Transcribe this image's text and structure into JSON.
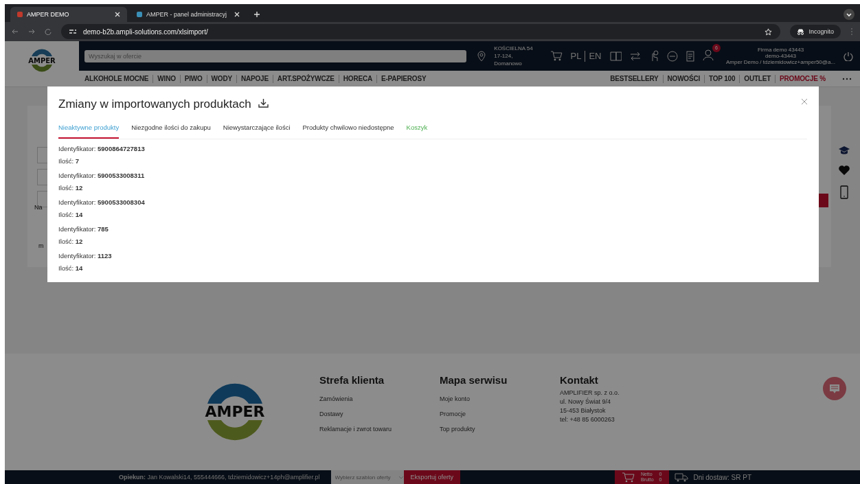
{
  "browser": {
    "tabs": [
      {
        "title": "AMPER DEMO",
        "selected": true
      },
      {
        "title": "AMPER - panel administracyj",
        "selected": false
      }
    ],
    "url": "demo-b2b.ampli-solutions.com/xlsimport/",
    "profile": "Incognito"
  },
  "header": {
    "logo": "AMPER",
    "search": {
      "placeholder": "Wyszukaj w ofercie"
    },
    "address": [
      "KOŚCIELNA 54",
      "17-124, Domanowo"
    ],
    "languages": [
      "PL",
      "EN"
    ],
    "notifications": "6",
    "account": [
      "Firma demo 43443",
      "demo-43443",
      "Amper Demo / tdziemidowicz+amper50@a..."
    ]
  },
  "categories": [
    {
      "label": "ALKOHOLE MOCNE",
      "promo": false
    },
    {
      "label": "WINO",
      "promo": false
    },
    {
      "label": "PIWO",
      "promo": false
    },
    {
      "label": "WODY",
      "promo": false
    },
    {
      "label": "NAPOJE",
      "promo": false
    },
    {
      "label": "ART.SPOŻYWCZE",
      "promo": false
    },
    {
      "label": "HORECA",
      "promo": false
    },
    {
      "label": "E-PAPIEROSY",
      "promo": false
    }
  ],
  "quick_links": [
    {
      "label": "BESTSELLERY",
      "promo": false
    },
    {
      "label": "NOWOŚCI",
      "promo": false
    },
    {
      "label": "TOP 100",
      "promo": false
    },
    {
      "label": "OUTLET",
      "promo": false
    },
    {
      "label": "PROMOCJE %",
      "promo": true
    }
  ],
  "background_fragments": [
    "Na",
    "m"
  ],
  "modal": {
    "title": "Zmiany w importowanych produktach",
    "tabs": [
      {
        "label": "Nieaktywne produkty",
        "selected": true,
        "kind": "filter"
      },
      {
        "label": "Niezgodne ilości do zakupu",
        "selected": false,
        "kind": "filter"
      },
      {
        "label": "Niewystarczające ilości",
        "selected": false,
        "kind": "filter"
      },
      {
        "label": "Produkty chwilowo niedostępne",
        "selected": false,
        "kind": "filter"
      },
      {
        "label": "Koszyk",
        "selected": false,
        "kind": "cart"
      }
    ],
    "items": [
      {
        "id": "Identyfikator: **5900864727813**",
        "qty": "Ilość: **7**"
      },
      {
        "id": "Identyfikator: **5900533008311**",
        "qty": "Ilość: **12**"
      },
      {
        "id": "Identyfikator: **5900533008304**",
        "qty": "Ilość: **14**"
      },
      {
        "id": "Identyfikator: **785**",
        "qty": "Ilość: **12**"
      },
      {
        "id": "Identyfikator: **1123**",
        "qty": "Ilość: **14**"
      }
    ]
  },
  "footer": {
    "logo": "AMPER",
    "columns": [
      {
        "title": "Strefa klienta",
        "lines": [
          "Zamówienia",
          "Dostawy",
          "Reklamacje i zwrot towaru"
        ]
      },
      {
        "title": "Mapa serwisu",
        "lines": [
          "Moje konto",
          "Promocje",
          "Top produkty"
        ]
      },
      {
        "title": "Kontakt",
        "lines": [
          "AMPLIFIER sp. z o.o.",
          "ul. Nowy Świat 9/4",
          "15-453 Białystok",
          "tel: +48 85 6000263"
        ]
      }
    ]
  },
  "bottom_bar": {
    "caretaker": "**Opiekun:** Jan Kowalski14, 555444666, tdziemidowicz+14ph@amplifier.pl",
    "template": {
      "placeholder": "Wybierz szablon oferty"
    },
    "export": "Eksportuj oferty",
    "cart": [
      {
        "label": "Netto",
        "value": "0"
      },
      {
        "label": "Brutto",
        "value": "0"
      }
    ],
    "delivery": "Dni dostaw: SR PT"
  }
}
